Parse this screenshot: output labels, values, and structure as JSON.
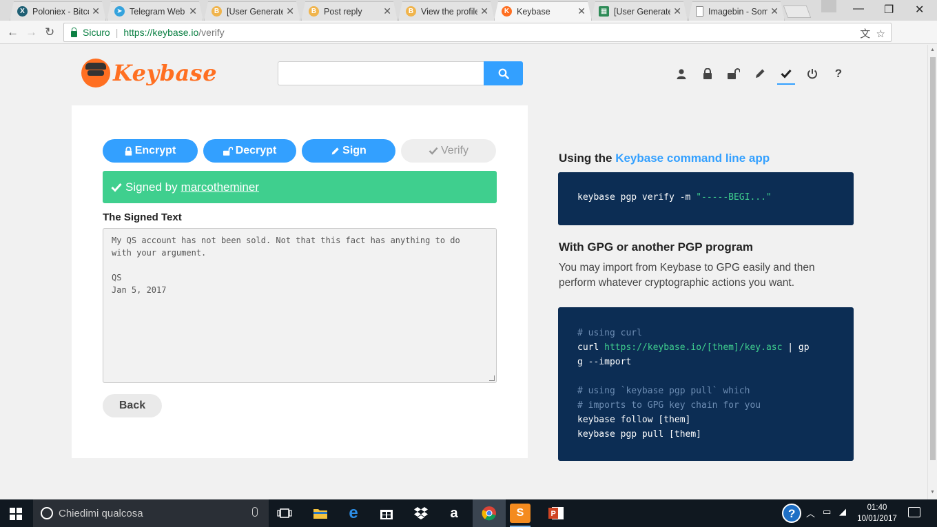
{
  "browser": {
    "tabs": [
      {
        "title": "Poloniex - Bitcoin",
        "icon": "poloniex-icon",
        "color": "#1e5f74"
      },
      {
        "title": "Telegram Web",
        "icon": "telegram-icon",
        "color": "#35a3dd"
      },
      {
        "title": "[User Generated]",
        "icon": "bitcoin-forum-icon",
        "color": "#f0b44c"
      },
      {
        "title": "Post reply",
        "icon": "bitcoin-forum-icon",
        "color": "#f0b44c"
      },
      {
        "title": "View the profile",
        "icon": "bitcoin-forum-icon",
        "color": "#f0b44c"
      },
      {
        "title": "Keybase",
        "icon": "keybase-icon",
        "color": "#ff6f21"
      },
      {
        "title": "[User Generated]",
        "icon": "sheet-icon",
        "color": "#2e8b57"
      },
      {
        "title": "Imagebin - Some",
        "icon": "page-icon",
        "color": "#888888"
      }
    ],
    "secure_label": "Sicuro",
    "url_host": "https://keybase.io",
    "url_path": "/verify"
  },
  "header": {
    "logo_text": "Keybase",
    "search_placeholder": "",
    "accent": "#33a0ff"
  },
  "verify": {
    "tabs": {
      "encrypt": "Encrypt",
      "decrypt": "Decrypt",
      "sign": "Sign",
      "verify": "Verify"
    },
    "banner_prefix": "Signed by",
    "signer": "marcotheminer",
    "signed_text_label": "The Signed Text",
    "signed_text": "My QS account has not been sold. Not that this fact has anything to do\nwith your argument.\n\nQS\nJan 5, 2017",
    "back_label": "Back"
  },
  "sidebar": {
    "cli_heading_prefix": "Using the",
    "cli_heading_link": "Keybase command line app",
    "cli_command": "keybase pgp verify -m ",
    "cli_string": "\"-----BEGI...\"",
    "gpg_heading": "With GPG or another PGP program",
    "gpg_paragraph": "You may import from Keybase to GPG easily and then perform whatever cryptographic actions you want.",
    "code": {
      "c1": "# using curl",
      "l1a": "curl ",
      "l1b": "https://keybase.io/[them]/key.asc",
      "l1c": " | gp",
      "l2": "g --import",
      "c2": "# using `keybase pgp pull` which",
      "c3": "# imports to GPG key chain for you",
      "l3": "keybase follow [them]",
      "l4": "keybase pgp pull [them]"
    }
  },
  "taskbar": {
    "search_placeholder": "Chiedimi qualcosa",
    "time": "01:40",
    "date": "10/01/2017"
  }
}
